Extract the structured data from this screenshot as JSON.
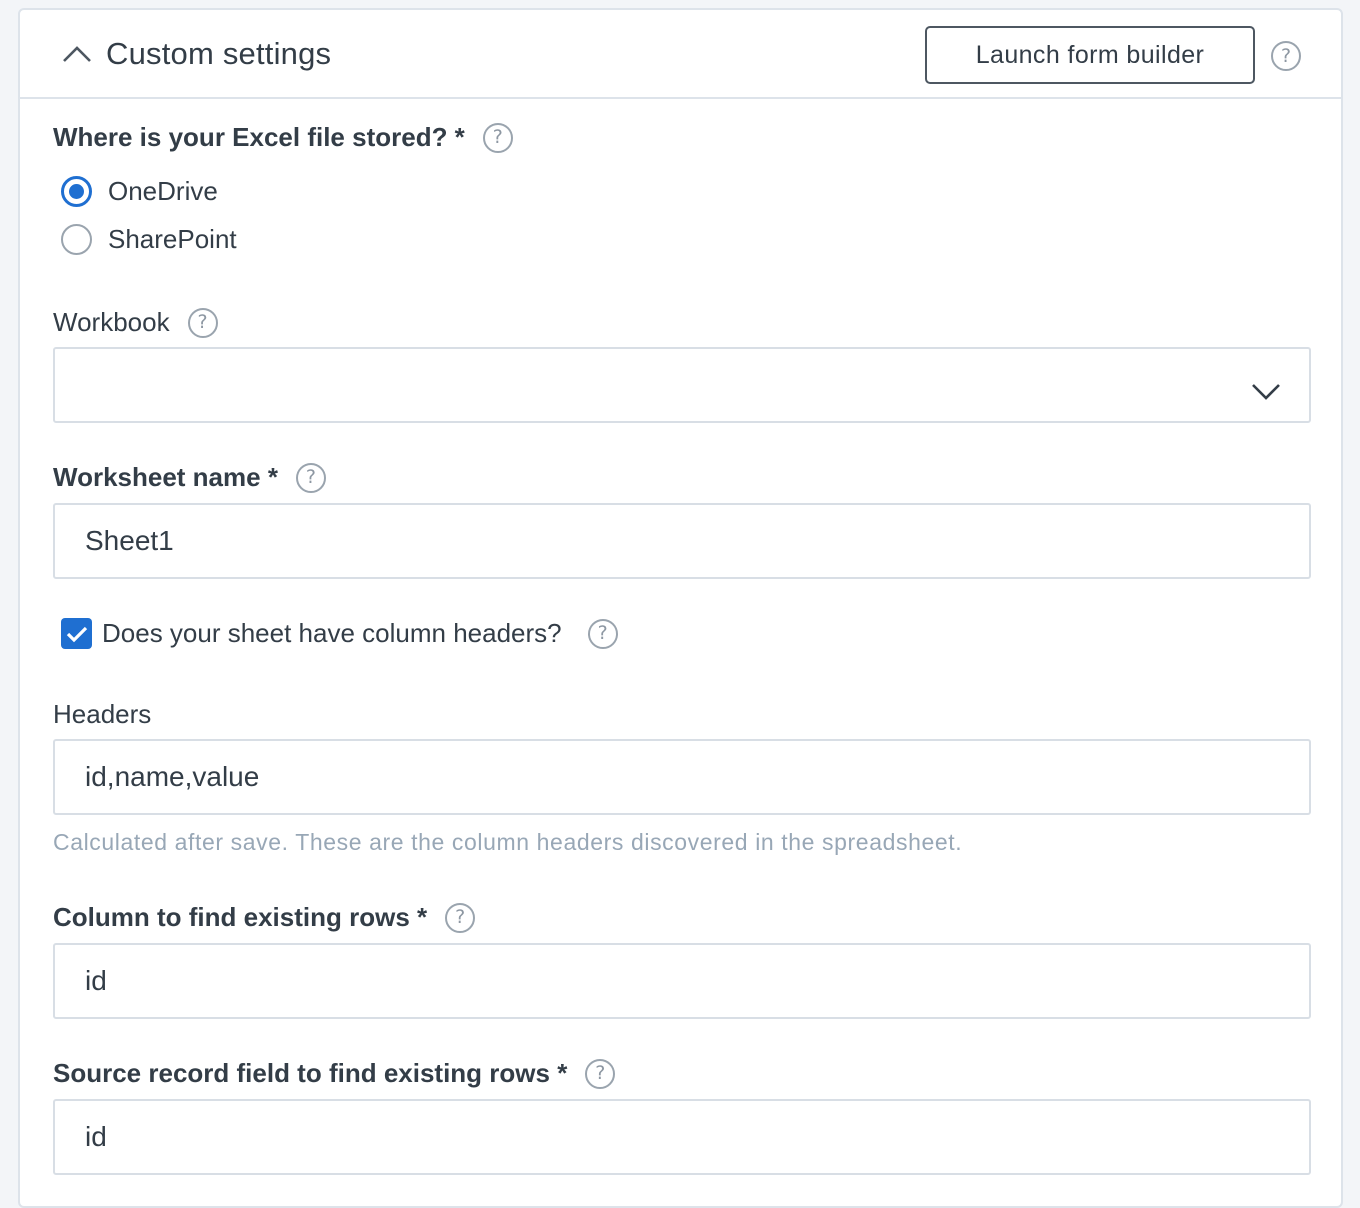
{
  "header": {
    "title": "Custom settings",
    "launch_button_label": "Launch form builder",
    "help_glyph": "?"
  },
  "storage": {
    "label": "Where is your Excel file stored? *",
    "help_glyph": "?",
    "options": [
      {
        "label": "OneDrive",
        "selected": true
      },
      {
        "label": "SharePoint",
        "selected": false
      }
    ]
  },
  "workbook": {
    "label": "Workbook",
    "help_glyph": "?",
    "value": ""
  },
  "worksheet": {
    "label": "Worksheet name *",
    "help_glyph": "?",
    "value": "Sheet1"
  },
  "column_headers_checkbox": {
    "label": "Does your sheet have column headers?",
    "checked": true,
    "help_glyph": "?"
  },
  "headers": {
    "label": "Headers",
    "value": "id,name,value",
    "hint": "Calculated after save. These are the column headers discovered in the spreadsheet."
  },
  "find_column": {
    "label": "Column to find existing rows *",
    "help_glyph": "?",
    "value": "id"
  },
  "source_field": {
    "label": "Source record field to find existing rows *",
    "help_glyph": "?",
    "value": "id"
  },
  "colors": {
    "accent": "#1f6fd1",
    "border": "#d8dee5",
    "text": "#333d47",
    "hint": "#98a7b6"
  }
}
